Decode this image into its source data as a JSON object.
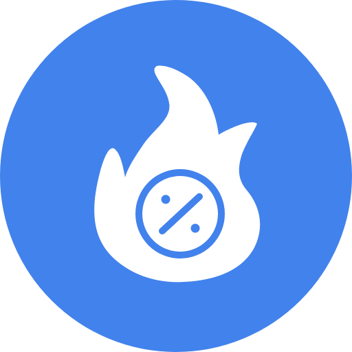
{
  "icon": {
    "name": "hot-deal-percent-icon",
    "background_color": "#4282EC",
    "foreground_color": "#FFFFFF",
    "elements": [
      "circle-background",
      "flame-icon",
      "percent-badge-icon"
    ]
  }
}
